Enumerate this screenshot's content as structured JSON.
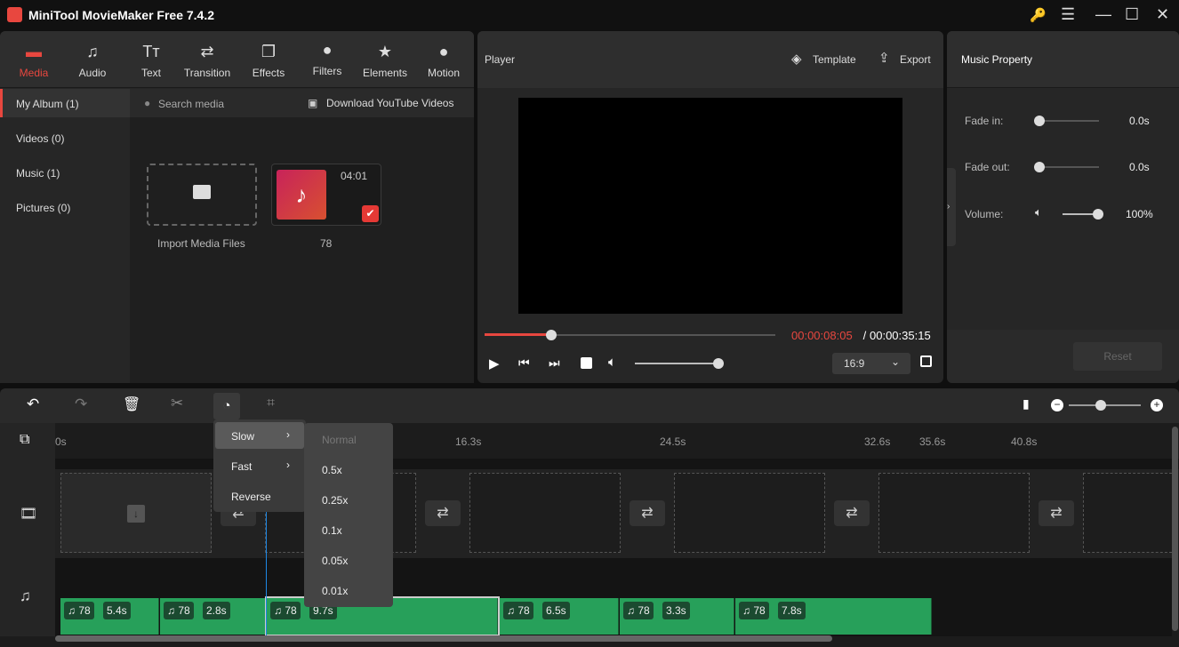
{
  "app": {
    "title": "MiniTool MovieMaker Free 7.4.2"
  },
  "toolbar": [
    {
      "label": "Media",
      "icon": "folder-icon",
      "active": true
    },
    {
      "label": "Audio",
      "icon": "music-icon"
    },
    {
      "label": "Text",
      "icon": "text-icon"
    },
    {
      "label": "Transition",
      "icon": "transition-icon"
    },
    {
      "label": "Effects",
      "icon": "effects-icon"
    },
    {
      "label": "Filters",
      "icon": "filters-icon"
    },
    {
      "label": "Elements",
      "icon": "elements-icon"
    },
    {
      "label": "Motion",
      "icon": "motion-icon"
    }
  ],
  "sidebar": [
    {
      "label": "My Album (1)",
      "active": true
    },
    {
      "label": "Videos (0)"
    },
    {
      "label": "Music (1)"
    },
    {
      "label": "Pictures (0)"
    }
  ],
  "media": {
    "search_placeholder": "Search media",
    "download_label": "Download YouTube Videos",
    "import_label": "Import Media Files",
    "items": [
      {
        "name": "78",
        "duration": "04:01",
        "checked": true
      }
    ]
  },
  "player": {
    "title": "Player",
    "template_label": "Template",
    "export_label": "Export",
    "current_time": "00:00:08:05",
    "separator": " / ",
    "total_time": "00:00:35:15",
    "progress": 0.23,
    "volume": 1.0,
    "aspect": "16:9"
  },
  "music_property": {
    "title": "Music Property",
    "fade_in_label": "Fade in:",
    "fade_in_value": "0.0s",
    "fade_out_label": "Fade out:",
    "fade_out_value": "0.0s",
    "volume_label": "Volume:",
    "volume_value": "100%",
    "reset_label": "Reset"
  },
  "timeline": {
    "ruler": [
      "0s",
      "16.3s",
      "24.5s",
      "32.6s",
      "35.6s",
      "40.8s"
    ],
    "audio_clips": [
      {
        "name": "78",
        "duration": "5.4s"
      },
      {
        "name": "78",
        "duration": "2.8s"
      },
      {
        "name": "78",
        "duration": "9.7s",
        "selected": true
      },
      {
        "name": "78",
        "duration": "6.5s"
      },
      {
        "name": "78",
        "duration": "3.3s"
      },
      {
        "name": "78",
        "duration": "7.8s"
      }
    ]
  },
  "speed_menu": {
    "items": [
      "Slow",
      "Fast",
      "Reverse"
    ],
    "submenu": [
      "Normal",
      "0.5x",
      "0.25x",
      "0.1x",
      "0.05x",
      "0.01x"
    ]
  },
  "colors": {
    "accent": "#e8473f",
    "clip": "#27a05a",
    "playhead": "#1e88e5"
  }
}
